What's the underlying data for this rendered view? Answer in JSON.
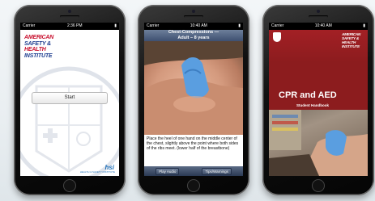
{
  "phones": [
    {
      "status": {
        "carrier": "Carrier",
        "time": "2:36 PM"
      },
      "logo_lines": [
        "AMERICAN",
        "SAFETY &",
        "HEALTH",
        "INSTITUTE"
      ],
      "start_label": "Start",
      "hsi_logo": "hsi",
      "hsi_sub": "HEALTH & SAFETY INSTITUTE"
    },
    {
      "status": {
        "carrier": "Carrier",
        "time": "10:40 AM"
      },
      "nav_title_1": "Chest-Compressions —",
      "nav_title_2": "Adult – 8 years",
      "caption": "Place the heel of one hand on the middle center of the chest, slightly above the point where both sides of the ribs meet. (lower half of the breastbone)",
      "dots": "• • • • ● • •",
      "buttons": [
        "Play Audio",
        "Tips/Warnings"
      ]
    },
    {
      "status": {
        "carrier": "Carrier",
        "time": "10:40 AM"
      },
      "logo_lines": [
        "AMERICAN",
        "SAFETY &",
        "HEALTH",
        "INSTITUTE"
      ],
      "title": "CPR and AED",
      "subtitle": "Student Handbook"
    }
  ],
  "colors": {
    "brand_red": "#c8102e",
    "brand_blue": "#1d3d8f",
    "cover_red": "#8c1c1e",
    "glove_blue": "#5a9ee0"
  }
}
